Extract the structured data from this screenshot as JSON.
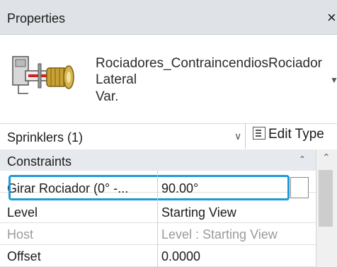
{
  "panel": {
    "title": "Properties",
    "close_glyph": "×"
  },
  "type_header": {
    "thumbnail_icon": "sprinkler-thumbnail-icon",
    "name": "Rociadores_ContraincendiosRociadorLateral",
    "variant": "Var."
  },
  "selector": {
    "value": "Sprinklers (1)",
    "edit_type_label": "Edit Type"
  },
  "groups": [
    {
      "label": "Constraints",
      "rows": [
        {
          "name": "Girar Rociador (0° -...",
          "value": "90.00°",
          "enabled": true
        },
        {
          "name": "Level",
          "value": "Starting View",
          "enabled": true
        },
        {
          "name": "Host",
          "value": "Level : Starting View",
          "enabled": false
        },
        {
          "name": "Offset",
          "value": "0.0000",
          "enabled": true
        }
      ]
    }
  ],
  "colors": {
    "highlight": "#1e9ad8",
    "header_bg": "#dfe3e8",
    "group_bg": "#e6e9ed",
    "accent_red": "#cc2222",
    "accent_gold": "#c9a236"
  }
}
